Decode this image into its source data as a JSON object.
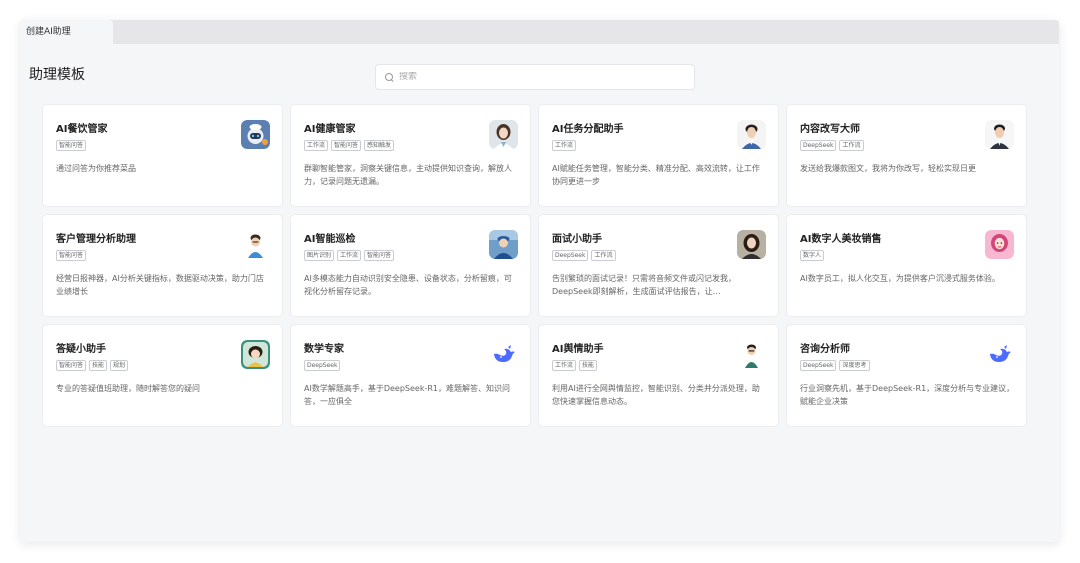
{
  "tabs": [
    {
      "label": "创建AI助理"
    }
  ],
  "page": {
    "title": "助理模板"
  },
  "search": {
    "placeholder": "搜索"
  },
  "cards": [
    {
      "title": "AI餐饮管家",
      "tags": [
        "智能问答"
      ],
      "desc": "通过问答为你推荐菜品",
      "avatar": "robot-chef-icon"
    },
    {
      "title": "AI健康管家",
      "tags": [
        "工作流",
        "智能问答",
        "感知触发"
      ],
      "desc": "群聊智能管家，洞察关键信息，主动提供知识查询，解放人力，记录问题无遗漏。",
      "avatar": "doctor-avatar"
    },
    {
      "title": "AI任务分配助手",
      "tags": [
        "工作流"
      ],
      "desc": "AI赋能任务管理，智能分类、精准分配、高效流转，让工作协同更进一步",
      "avatar": "man-avatar"
    },
    {
      "title": "内容改写大师",
      "tags": [
        "DeepSeek",
        "工作流"
      ],
      "desc": "发送给我爆款图文，我将为你改写，轻松实现日更",
      "avatar": "man-suit-avatar"
    },
    {
      "title": "客户管理分析助理",
      "tags": [
        "智能问答"
      ],
      "desc": "经营日报神器，AI分析关键指标，数据驱动决策，助力门店业绩增长",
      "avatar": "cartoon-man-avatar"
    },
    {
      "title": "AI智能巡检",
      "tags": [
        "图片识别",
        "工作流",
        "智能问答"
      ],
      "desc": "AI多模态能力自动识别安全隐患、设备状态，分析留痕，可视化分析留存记录。",
      "avatar": "inspector-avatar"
    },
    {
      "title": "面试小助手",
      "tags": [
        "DeepSeek",
        "工作流"
      ],
      "desc": "告别繁琐的面试记录！只需将音频文件或闪记发我，DeepSeek即刻解析，生成面试评估报告，让…",
      "avatar": "woman-avatar"
    },
    {
      "title": "AI数字人美妆销售",
      "tags": [
        "数字人"
      ],
      "desc": "AI数字员工，拟人化交互，为提供客户沉浸式服务体验。",
      "avatar": "makeup-woman-avatar"
    },
    {
      "title": "答疑小助手",
      "tags": [
        "智能问答",
        "技能",
        "规划"
      ],
      "desc": "专业的答疑值班助理，随时解答您的疑问",
      "avatar": "cartoon-girl-avatar"
    },
    {
      "title": "数学专家",
      "tags": [
        "DeepSeek"
      ],
      "desc": "AI数学解题高手，基于DeepSeek-R1，难题解答、知识问答，一应俱全",
      "avatar": "deepseek-whale-icon"
    },
    {
      "title": "AI舆情助手",
      "tags": [
        "工作流",
        "技能"
      ],
      "desc": "利用AI进行全网舆情监控，智能识别、分类并分派处理，助您快速掌握信息动态。",
      "avatar": "cartoon-analyst-avatar"
    },
    {
      "title": "咨询分析师",
      "tags": [
        "DeepSeek",
        "深度思考"
      ],
      "desc": "行业洞察先机，基于DeepSeek-R1，深度分析与专业建议，赋能企业决策",
      "avatar": "deepseek-whale-icon"
    }
  ],
  "colors": {
    "accent": "#4d6bfe",
    "bg": "#f5f6f8",
    "card_border": "#ebedf0"
  }
}
